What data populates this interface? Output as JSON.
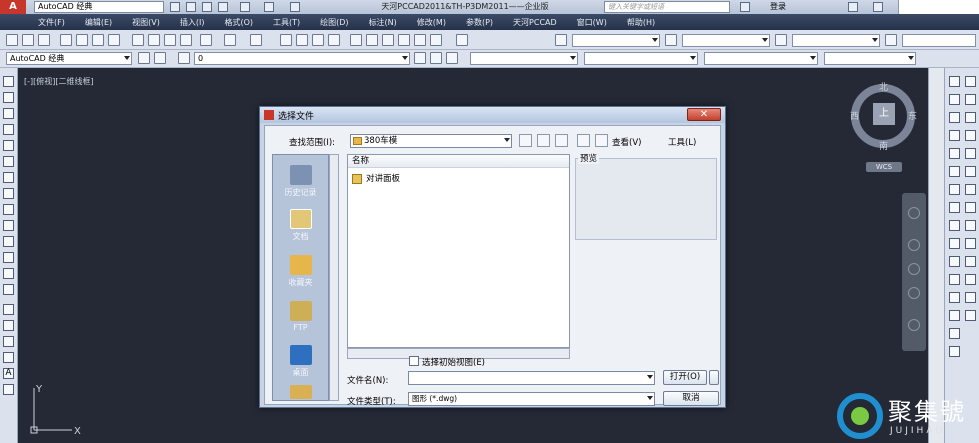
{
  "titlebar": {
    "workspace": "AutoCAD 经典",
    "window_title": "天河PCCAD2011&TH-P3DM2011——企业版",
    "search_placeholder": "键入关键字或短语",
    "login": "登录"
  },
  "menu": [
    "文件(F)",
    "编辑(E)",
    "视图(V)",
    "插入(I)",
    "格式(O)",
    "工具(T)",
    "绘图(D)",
    "标注(N)",
    "修改(M)",
    "参数(P)",
    "天河PCCAD",
    "窗口(W)",
    "帮助(H)"
  ],
  "toolbar2": {
    "workspace_combo": "AutoCAD 经典",
    "layer_combo": "0"
  },
  "viewport_label": "[-][俯视][二维线框]",
  "viewcube": {
    "north": "北",
    "south": "南",
    "east": "东",
    "west": "西",
    "face": "上",
    "wcs": "WCS"
  },
  "ucs": {
    "x": "X",
    "y": "Y"
  },
  "watermark": {
    "name": "聚集號",
    "sub": "JUJIHAO"
  },
  "dialog": {
    "title": "选择文件",
    "close": "✕",
    "look_in_label": "查找范围(I):",
    "look_in_value": "380车模",
    "views_label": "查看(V)",
    "tools_label": "工具(L)",
    "places": [
      "历史记录",
      "文档",
      "收藏夹",
      "FTP",
      "桌面"
    ],
    "column_name": "名称",
    "files": [
      "对讲面板"
    ],
    "preview_label": "预览",
    "initial_view_checkbox": "选择初始视图(E)",
    "filename_label": "文件名(N):",
    "filename_value": "",
    "filetype_label": "文件类型(T):",
    "filetype_value": "图形 (*.dwg)",
    "open_button": "打开(O)",
    "cancel_button": "取消"
  }
}
